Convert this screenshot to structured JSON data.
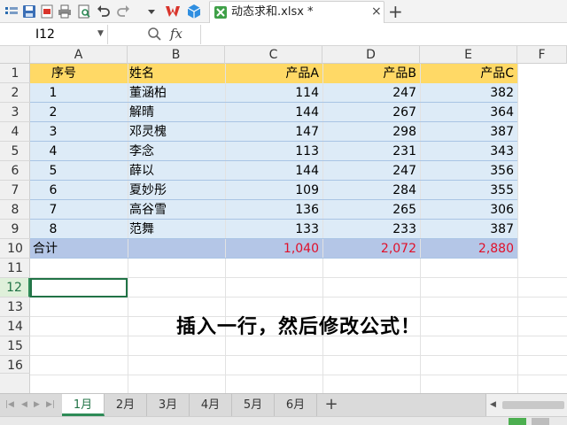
{
  "toolbar": {
    "file_tab_label": "动态求和.xlsx *",
    "close_symbol": "×",
    "new_tab_symbol": "+"
  },
  "formula_bar": {
    "name_box": "I12",
    "fx": "fx",
    "formula": ""
  },
  "columns": [
    "A",
    "B",
    "C",
    "D",
    "E",
    "F"
  ],
  "rows": [
    "1",
    "2",
    "3",
    "4",
    "5",
    "6",
    "7",
    "8",
    "9",
    "10",
    "11",
    "12",
    "13",
    "14",
    "15",
    "16"
  ],
  "table": {
    "headers": [
      "序号",
      "姓名",
      "产品A",
      "产品B",
      "产品C"
    ],
    "rows": [
      [
        "1",
        "董涵柏",
        "114",
        "247",
        "382"
      ],
      [
        "2",
        "解晴",
        "144",
        "267",
        "364"
      ],
      [
        "3",
        "邓灵槐",
        "147",
        "298",
        "387"
      ],
      [
        "4",
        "李念",
        "113",
        "231",
        "343"
      ],
      [
        "5",
        "薛以",
        "144",
        "247",
        "356"
      ],
      [
        "6",
        "夏妙彤",
        "109",
        "284",
        "355"
      ],
      [
        "7",
        "高谷雪",
        "136",
        "265",
        "306"
      ],
      [
        "8",
        "范舞",
        "133",
        "233",
        "387"
      ]
    ],
    "total": {
      "label": "合计",
      "a": "1,040",
      "b": "2,072",
      "c": "2,880"
    }
  },
  "note": "插入一行，然后修改公式！",
  "sheets": [
    "1月",
    "2月",
    "3月",
    "4月",
    "5月",
    "6月"
  ],
  "active_sheet": "1月",
  "add_sheet_symbol": "+",
  "colors": {
    "header_fill": "#ffd966",
    "body_fill": "#ddebf7",
    "total_fill": "#b4c6e7",
    "total_text": "#e0102a",
    "accent": "#217346"
  }
}
